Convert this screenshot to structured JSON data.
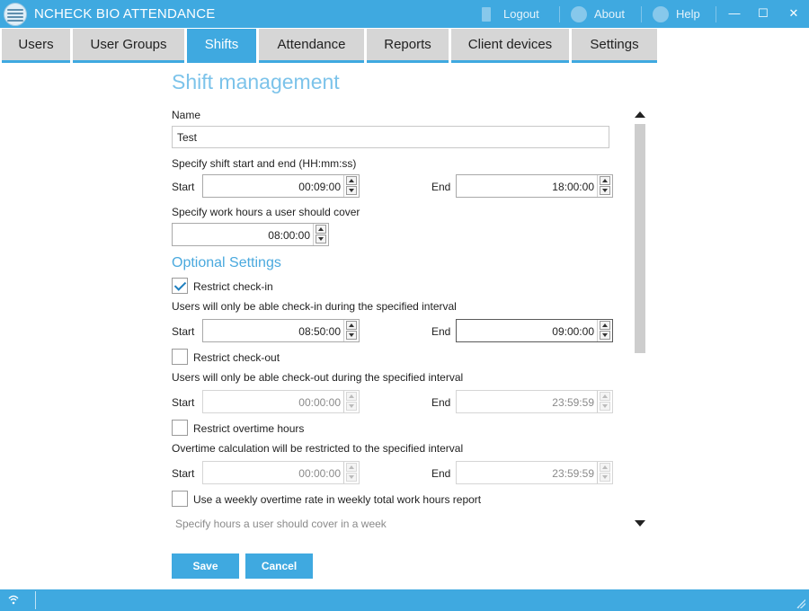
{
  "app": {
    "title": "NCHECK BIO ATTENDANCE"
  },
  "titlebar": {
    "logout_label": "Logout",
    "about_label": "About",
    "help_label": "Help",
    "minimize_glyph": "—",
    "maximize_glyph": "☐",
    "close_glyph": "✕"
  },
  "tabs": [
    {
      "label": "Users"
    },
    {
      "label": "User Groups"
    },
    {
      "label": "Shifts",
      "active": true
    },
    {
      "label": "Attendance"
    },
    {
      "label": "Reports"
    },
    {
      "label": "Client devices"
    },
    {
      "label": "Settings"
    }
  ],
  "form": {
    "heading": "Shift management",
    "name_label": "Name",
    "name_value": "Test",
    "shift_range_label": "Specify shift start and end (HH:mm:ss)",
    "start_label": "Start",
    "end_label": "End",
    "shift_start": "00:09:00",
    "shift_end": "18:00:00",
    "work_hours_label": "Specify work hours a user should cover",
    "work_hours": "08:00:00",
    "optional_heading": "Optional Settings",
    "restrict_checkin": {
      "label": "Restrict check-in",
      "checked": true,
      "description": "Users will only be able check-in during the specified interval",
      "start": "08:50:00",
      "end": "09:00:00"
    },
    "restrict_checkout": {
      "label": "Restrict check-out",
      "checked": false,
      "description": "Users will only be able check-out during the specified interval",
      "start": "00:00:00",
      "end": "23:59:59"
    },
    "restrict_overtime": {
      "label": "Restrict overtime hours",
      "checked": false,
      "description": "Overtime calculation will be restricted to the specified interval",
      "start": "00:00:00",
      "end": "23:59:59"
    },
    "weekly_overtime": {
      "label": "Use a weekly overtime rate in weekly total work hours report",
      "checked": false,
      "description": "Specify hours a user should cover in a week"
    },
    "save_label": "Save",
    "cancel_label": "Cancel"
  },
  "colors": {
    "accent": "#3fa9e0",
    "heading": "#7cc3ea",
    "tab_inactive": "#d6d6d6"
  }
}
